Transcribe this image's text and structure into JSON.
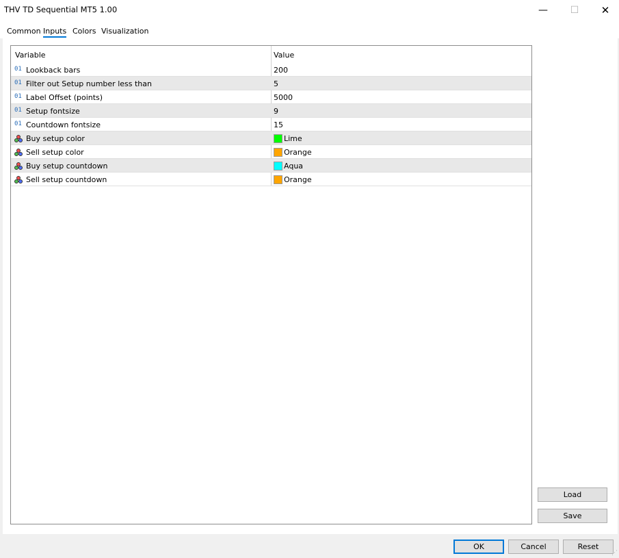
{
  "window": {
    "title": "THV TD Sequential MT5 1.00",
    "minimize": "—",
    "maximize": "☐",
    "close": "✕"
  },
  "tabs": [
    {
      "label": "Common"
    },
    {
      "label": "Inputs"
    },
    {
      "label": "Colors"
    },
    {
      "label": "Visualization"
    }
  ],
  "active_tab": "Inputs",
  "grid": {
    "headers": {
      "variable": "Variable",
      "value": "Value"
    },
    "number_icon": "01",
    "rows": [
      {
        "name": "Lookback bars",
        "value": "200",
        "kind": "number"
      },
      {
        "name": "Filter out Setup number less than",
        "value": "5",
        "kind": "number"
      },
      {
        "name": "Label Offset (points)",
        "value": "5000",
        "kind": "number"
      },
      {
        "name": "Setup fontsize",
        "value": "9",
        "kind": "number"
      },
      {
        "name": "Countdown fontsize",
        "value": "15",
        "kind": "number"
      },
      {
        "name": "Buy setup color",
        "value": "Lime",
        "kind": "color",
        "color": "#00ff00"
      },
      {
        "name": "Sell setup color",
        "value": "Orange",
        "kind": "color",
        "color": "#ffa500"
      },
      {
        "name": "Buy setup countdown",
        "value": "Aqua",
        "kind": "color",
        "color": "#00ffff"
      },
      {
        "name": "Sell setup countdown",
        "value": "Orange",
        "kind": "color",
        "color": "#ffa500"
      }
    ]
  },
  "side_buttons": {
    "load": "Load",
    "save": "Save"
  },
  "footer_buttons": {
    "ok": "OK",
    "cancel": "Cancel",
    "reset": "Reset"
  },
  "colors": {
    "accent": "#0078d7",
    "alt_row": "#e8e8e8"
  }
}
